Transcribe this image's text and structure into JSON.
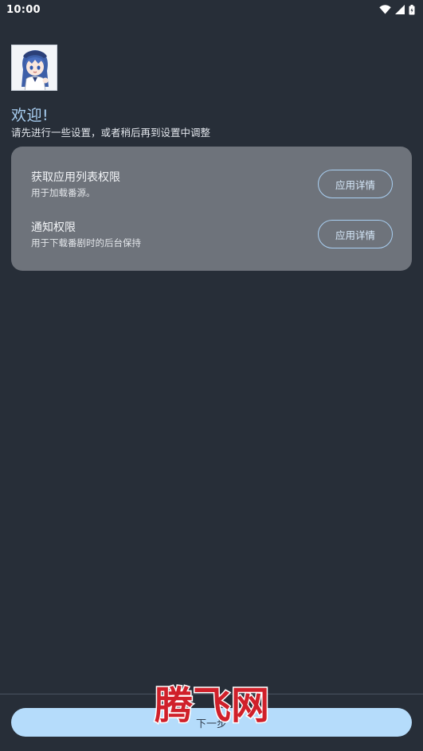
{
  "status_bar": {
    "time": "10:00",
    "icons": [
      "wifi-icon",
      "signal-icon",
      "battery-icon"
    ]
  },
  "welcome": {
    "title": "欢迎!",
    "subtitle": "请先进行一些设置，或者稍后再到设置中调整"
  },
  "permissions": [
    {
      "title": "获取应用列表权限",
      "description": "用于加载番源。",
      "button_label": "应用详情"
    },
    {
      "title": "通知权限",
      "description": "用于下载番剧时的后台保持",
      "button_label": "应用详情"
    }
  ],
  "next_button": {
    "label": "下一步"
  },
  "watermark": {
    "text": "腾飞网"
  },
  "colors": {
    "background": "#272e38",
    "card": "#6e737b",
    "accent": "#a9cff2",
    "primary_button": "#b5dcfb",
    "watermark": "#d0202a"
  }
}
